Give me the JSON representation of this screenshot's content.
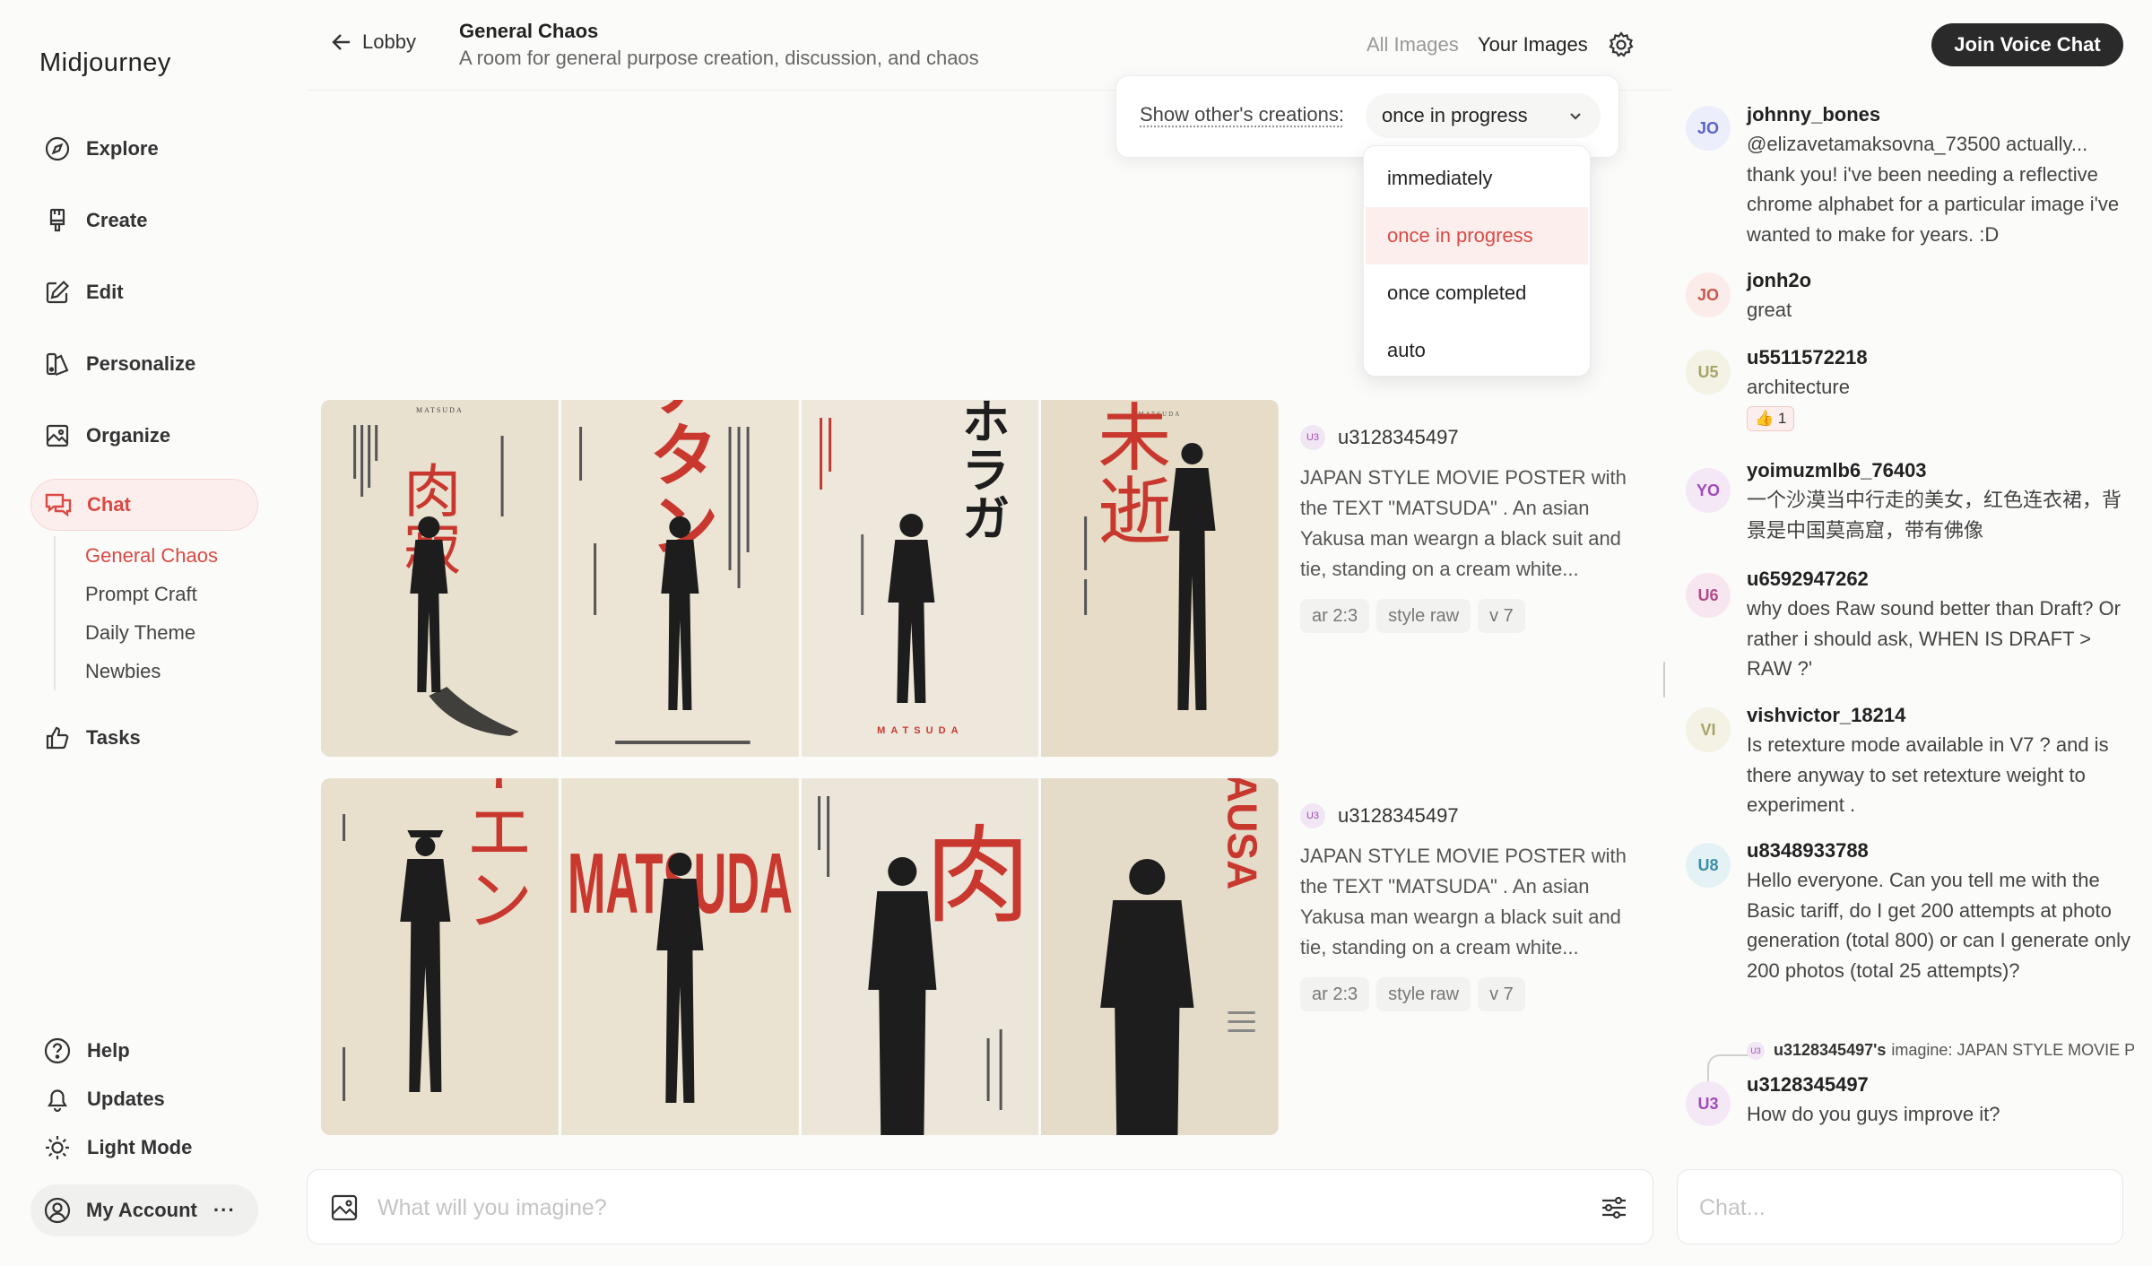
{
  "app": {
    "logo": "Midjourney"
  },
  "sidebar": {
    "items": [
      {
        "label": "Explore",
        "icon": "compass-icon"
      },
      {
        "label": "Create",
        "icon": "brush-icon"
      },
      {
        "label": "Edit",
        "icon": "edit-icon"
      },
      {
        "label": "Personalize",
        "icon": "personalize-icon"
      },
      {
        "label": "Organize",
        "icon": "image-folder-icon"
      },
      {
        "label": "Chat",
        "icon": "chat-icon"
      },
      {
        "label": "Tasks",
        "icon": "thumbs-up-icon"
      }
    ],
    "chat_rooms": [
      "General Chaos",
      "Prompt Craft",
      "Daily Theme",
      "Newbies"
    ],
    "bottom": {
      "help": "Help",
      "updates": "Updates",
      "light_mode": "Light Mode",
      "account": "My Account",
      "account_more": "···"
    }
  },
  "header": {
    "back_label": "Lobby",
    "room_title": "General Chaos",
    "room_desc": "A room for general purpose creation, discussion, and chaos",
    "tab_all": "All Images",
    "tab_yours": "Your Images",
    "voice_button": "Join Voice Chat"
  },
  "filter": {
    "label": "Show other's creations:",
    "selected": "once in progress",
    "options": [
      "immediately",
      "once in progress",
      "once completed",
      "auto"
    ]
  },
  "posts": [
    {
      "badge": "U3",
      "user": "u3128345497",
      "prompt": "JAPAN STYLE MOVIE POSTER with the TEXT \"MATSUDA\" . An asian Yakusa man weargn a black suit and tie, standing on a cream white...",
      "chips": [
        "ar 2:3",
        "style raw",
        "v 7"
      ],
      "posters": [
        {
          "glyphs": "肉寂",
          "top_text": "MATSUDA"
        },
        {
          "glyphs": "アタン",
          "top_text": ""
        },
        {
          "glyphs": "台ホラガ",
          "bottom_text": "MATSUDA"
        },
        {
          "glyphs": "逃未逝",
          "top_text": "MATSUDA"
        }
      ]
    },
    {
      "badge": "U3",
      "user": "u3128345497",
      "prompt": "JAPAN STYLE MOVIE POSTER with the TEXT \"MATSUDA\" . An asian Yakusa man weargn a black suit and tie, standing on a cream white...",
      "chips": [
        "ar 2:3",
        "style raw",
        "v 7"
      ],
      "posters": [
        {
          "glyphs": "ヴーエン"
        },
        {
          "glyphs": "MATSUDA"
        },
        {
          "glyphs": "肉"
        },
        {
          "glyphs": "MAUSA"
        }
      ]
    }
  ],
  "chat": [
    {
      "initials": "JO",
      "color": "#5a63c9",
      "bg": "#eceefb",
      "name": "johnny_bones",
      "text": "@elizavetamaksovna_73500 actually... thank you! i've been needing a reflective chrome alphabet for a particular image i've wanted to make for years. :D"
    },
    {
      "initials": "JO",
      "color": "#c8584e",
      "bg": "#fbebe9",
      "name": "jonh2o",
      "text": "great"
    },
    {
      "initials": "U5",
      "color": "#a8a468",
      "bg": "#f3f2e4",
      "name": "u5511572218",
      "text": "architecture",
      "reaction": "👍 1"
    },
    {
      "initials": "YO",
      "color": "#a04cb8",
      "bg": "#f4e8f7",
      "name": "yoimuzmlb6_76403",
      "text": "一个沙漠当中行走的美女，红色连衣裙，背景是中国莫高窟，带有佛像"
    },
    {
      "initials": "U6",
      "color": "#b14a8a",
      "bg": "#f7e6f0",
      "name": "u6592947262",
      "text": "why does Raw sound better than Draft? Or rather i should ask, WHEN IS DRAFT > RAW ?'"
    },
    {
      "initials": "VI",
      "color": "#a8a468",
      "bg": "#f3f2e4",
      "name": "vishvictor_18214",
      "text": "Is retexture mode available in V7 ? and is there anyway to set retexture weight to experiment ."
    },
    {
      "initials": "U8",
      "color": "#3a8fa8",
      "bg": "#e4f2f6",
      "name": "u8348933788",
      "text": "Hello everyone. Can you tell me with the Basic tariff, do I get 200 attempts at photo generation (total 800) or can I generate only 200 photos (total 25 attempts)?"
    },
    {
      "initials": "U3",
      "color": "#a04cb8",
      "bg": "#f4e8f7",
      "name": "u3128345497",
      "text": "How do you guys improve it?"
    }
  ],
  "reply_ref": {
    "badge": "U3",
    "user": "u3128345497's",
    "text": "imagine: JAPAN STYLE MOVIE POSTER with the TEXT \"MATSUDA\""
  },
  "composer": {
    "placeholder": "What will you imagine?"
  },
  "chat_input": {
    "placeholder": "Chat..."
  },
  "colors": {
    "accent": "#d94a43",
    "poster_red": "#c8382f",
    "poster_cream": "#ebe3d2"
  }
}
